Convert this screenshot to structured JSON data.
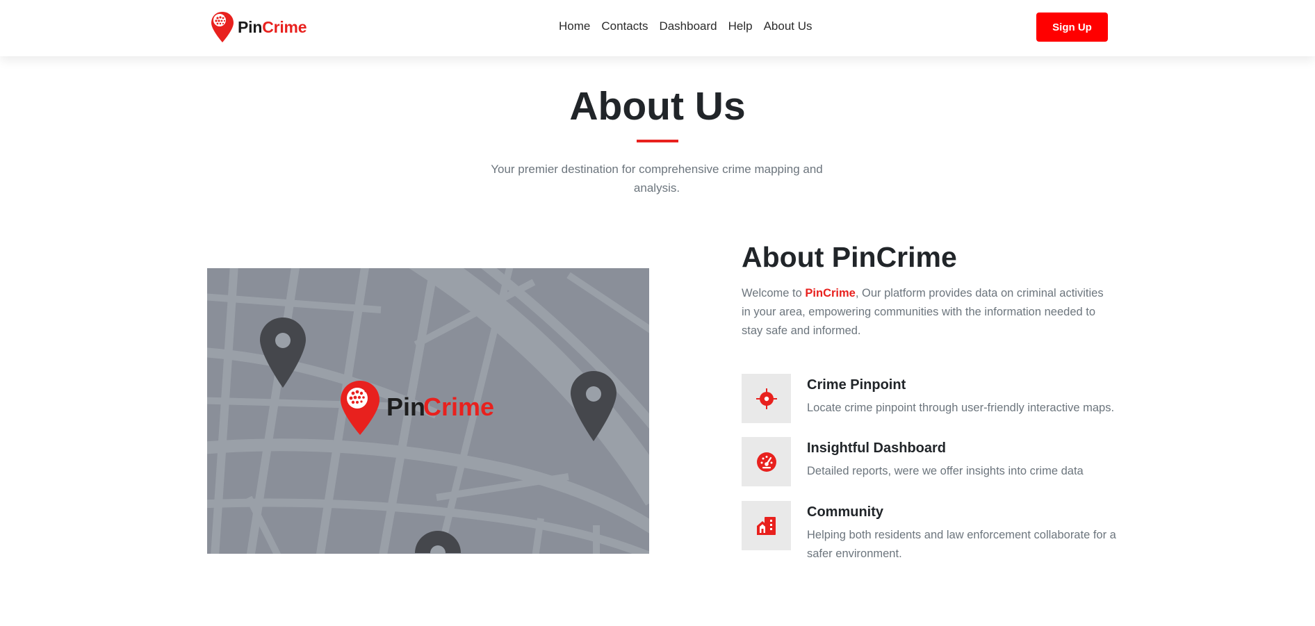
{
  "brand": {
    "name_part1": "Pin",
    "name_part2": "Crime",
    "logo_icon": "map-pin-logo-icon"
  },
  "nav": {
    "links": [
      "Home",
      "Contacts",
      "Dashboard",
      "Help",
      "About Us"
    ],
    "signup_label": "Sign Up"
  },
  "hero": {
    "title": "About Us",
    "subtitle": "Your premier destination for comprehensive crime mapping and analysis."
  },
  "map_image": {
    "logo_pin": "Pin",
    "logo_crime": "Crime",
    "markers": [
      "map-marker-icon",
      "map-marker-icon",
      "map-marker-icon"
    ]
  },
  "about": {
    "title": "About PinCrime",
    "text_before": "Welcome to ",
    "highlight": "PinCrime",
    "text_after": ", Our platform provides data on criminal activities in your area, empowering communities with the information needed to stay safe and informed."
  },
  "features": [
    {
      "icon": "crosshair-icon",
      "title": "Crime Pinpoint",
      "description": "Locate crime pinpoint through user-friendly interactive maps."
    },
    {
      "icon": "speedometer-icon",
      "title": "Insightful Dashboard",
      "description": "Detailed reports, were we offer insights into crime data"
    },
    {
      "icon": "building-icon",
      "title": "Community",
      "description": "Helping both residents and law enforcement collaborate for a safer environment."
    }
  ],
  "colors": {
    "accent": "#e8211e",
    "button": "#ff0000",
    "text_dark": "#212529",
    "text_muted": "#6c757d",
    "icon_box": "#e9e9e9",
    "map_bg": "#8b909a",
    "map_road": "#9ba0a8",
    "map_marker": "#45474c"
  }
}
